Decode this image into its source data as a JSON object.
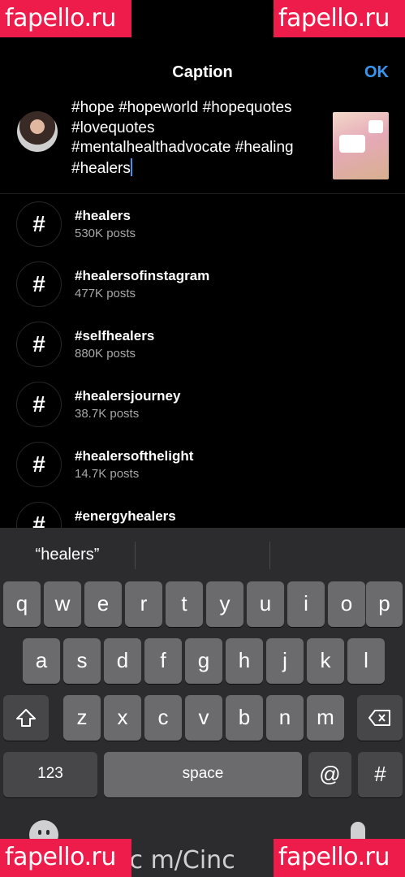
{
  "watermarks": {
    "top_left": "fapello.ru",
    "top_right": "fapello.ru",
    "bottom_left": "fapello.ru",
    "bottom_right": "fapello.ru",
    "center_bottom": ".c m/Cinc"
  },
  "header": {
    "title": "Caption",
    "ok_label": "OK"
  },
  "composer": {
    "caption_lines": [
      "#hope #hopeworld #hopequotes",
      "#lovequotes",
      "#mentalhealthadvocate #healing",
      "#healers"
    ]
  },
  "suggestions": [
    {
      "icon": "hashtag-icon",
      "symbol": "#",
      "name": "#healers",
      "count": "530K posts"
    },
    {
      "icon": "hashtag-icon",
      "symbol": "#",
      "name": "#healersofinstagram",
      "count": "477K posts"
    },
    {
      "icon": "hashtag-icon",
      "symbol": "#",
      "name": "#selfhealers",
      "count": "880K posts"
    },
    {
      "icon": "hashtag-icon",
      "symbol": "#",
      "name": "#healersjourney",
      "count": "38.7K posts"
    },
    {
      "icon": "hashtag-icon",
      "symbol": "#",
      "name": "#healersofthelight",
      "count": "14.7K posts"
    },
    {
      "icon": "hashtag-icon",
      "symbol": "#",
      "name": "#energyhealers",
      "count": ""
    }
  ],
  "keyboard": {
    "prediction": "“healers”",
    "row1": [
      "q",
      "w",
      "e",
      "r",
      "t",
      "y",
      "u",
      "i",
      "o",
      "p"
    ],
    "row2": [
      "a",
      "s",
      "d",
      "f",
      "g",
      "h",
      "j",
      "k",
      "l"
    ],
    "row3": [
      "z",
      "x",
      "c",
      "v",
      "b",
      "n",
      "m"
    ],
    "numbers_label": "123",
    "space_label": "space",
    "at_label": "@",
    "hash_label": "#"
  },
  "colors": {
    "accent": "#3897f0",
    "background": "#000000",
    "keyboard_bg": "#2c2c2e",
    "key_bg": "#6b6b6d",
    "watermark_bg": "#ee1c4a"
  }
}
